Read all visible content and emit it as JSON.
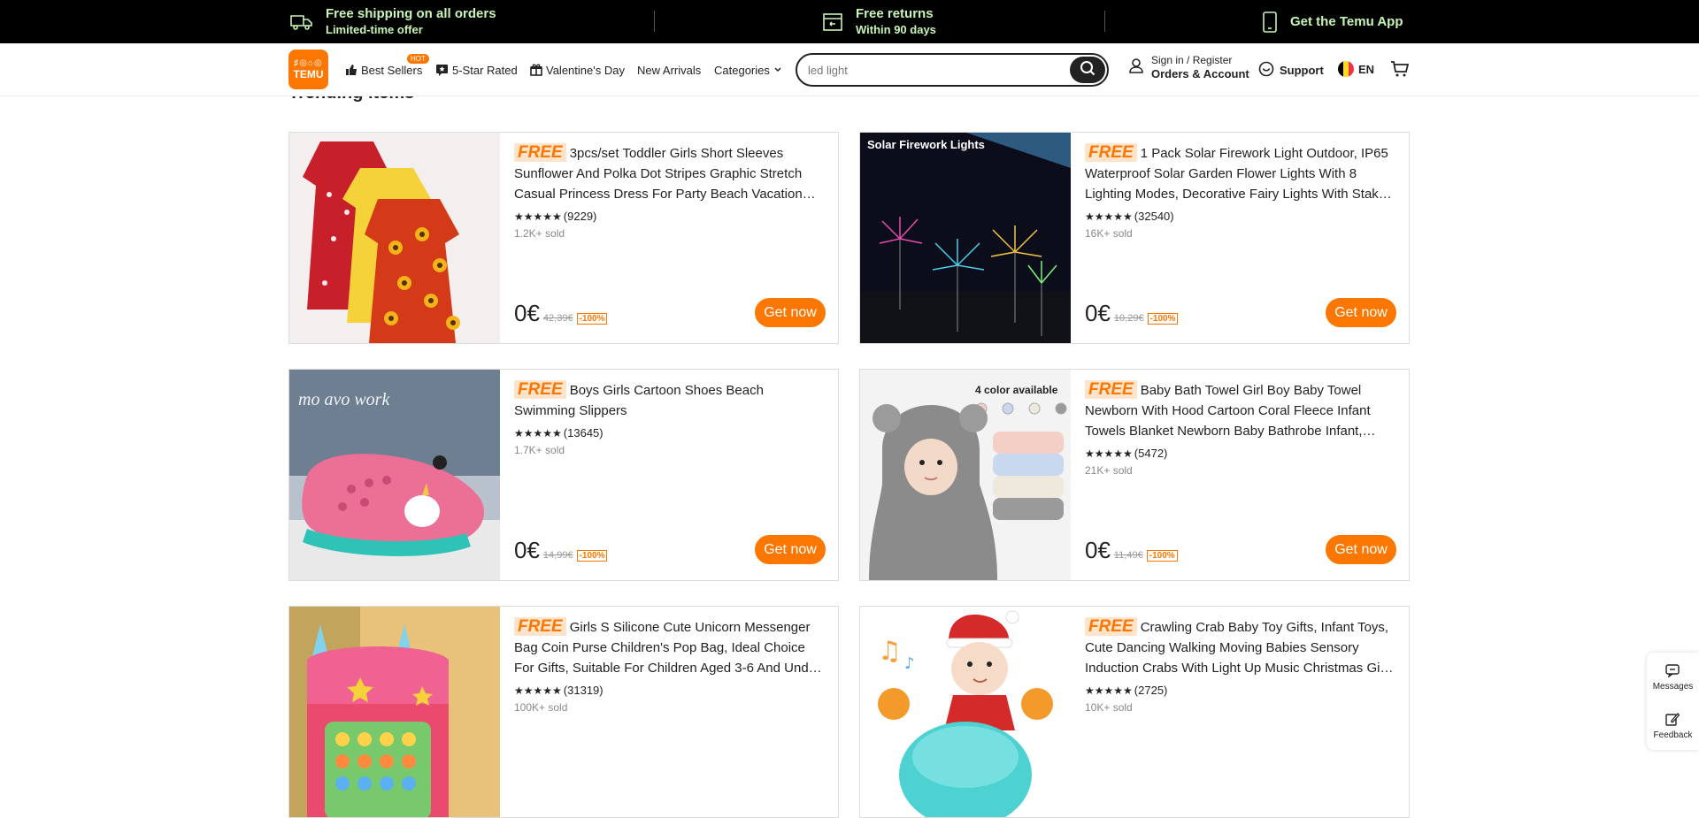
{
  "promo": {
    "shipping_title": "Free shipping on all orders",
    "shipping_sub": "Limited-time offer",
    "returns_title": "Free returns",
    "returns_sub": "Within 90 days",
    "app": "Get the Temu App"
  },
  "header": {
    "logo_top": "♯◎⌂◎",
    "logo_bottom": "TEMU",
    "nav": {
      "best_sellers": "Best Sellers",
      "hot": "HOT",
      "five_star": "5-Star Rated",
      "valentines": "Valentine's Day",
      "new_arrivals": "New Arrivals",
      "categories": "Categories"
    },
    "search_value": "led light",
    "account_line1": "Sign in / Register",
    "account_line2": "Orders & Account",
    "support": "Support",
    "language": "EN"
  },
  "section_title": "Trending items",
  "colors": {
    "accent": "#fb7701",
    "promo_text": "#c8f5b4",
    "promo_bg": "#000000"
  },
  "cards": [
    {
      "free": "FREE",
      "title": "3pcs/set Toddler Girls Short Sleeves Sunflower And Polka Dot Stripes Graphic Stretch Casual Princess Dress For Party Beach Vacation…",
      "stars": "★★★★★",
      "reviews": "(9229)",
      "sold": "1.2K+ sold",
      "price": "0€",
      "original": "42,39€",
      "discount": "-100%",
      "button": "Get now"
    },
    {
      "free": "FREE",
      "title": "1 Pack Solar Firework Light Outdoor, IP65 Waterproof Solar Garden Flower Lights With 8 Lighting Modes, Decorative Fairy Lights With Stak…",
      "stars": "★★★★★",
      "reviews": "(32540)",
      "sold": "16K+ sold",
      "price": "0€",
      "original": "10,29€",
      "discount": "-100%",
      "button": "Get now",
      "img_text": "Solar Firework Lights"
    },
    {
      "free": "FREE",
      "title": "Boys Girls Cartoon Shoes Beach Swimming Slippers",
      "stars": "★★★★★",
      "reviews": "(13645)",
      "sold": "1.7K+ sold",
      "price": "0€",
      "original": "14,99€",
      "discount": "-100%",
      "button": "Get now"
    },
    {
      "free": "FREE",
      "title": "Baby Bath Towel Girl Boy Baby Towel Newborn With Hood Cartoon Coral Fleece Infant Towels Blanket Newborn Baby Bathrobe Infant,…",
      "stars": "★★★★★",
      "reviews": "(5472)",
      "sold": "21K+ sold",
      "price": "0€",
      "original": "11,49€",
      "discount": "-100%",
      "button": "Get now",
      "img_text": "4 color available"
    },
    {
      "free": "FREE",
      "title": "Girls S Silicone Cute Unicorn Messenger Bag Coin Purse Children's Pop Bag, Ideal Choice For Gifts, Suitable For Children Aged 3-6 And Und…",
      "stars": "★★★★★",
      "reviews": "(31319)",
      "sold": "100K+ sold"
    },
    {
      "free": "FREE",
      "title": "Crawling Crab Baby Toy Gifts, Infant Toys, Cute Dancing Walking Moving Babies Sensory Induction Crabs With Light Up Music Christmas Gi…",
      "stars": "★★★★★",
      "reviews": "(2725)",
      "sold": "10K+ sold"
    }
  ],
  "side": {
    "messages": "Messages",
    "feedback": "Feedback"
  }
}
